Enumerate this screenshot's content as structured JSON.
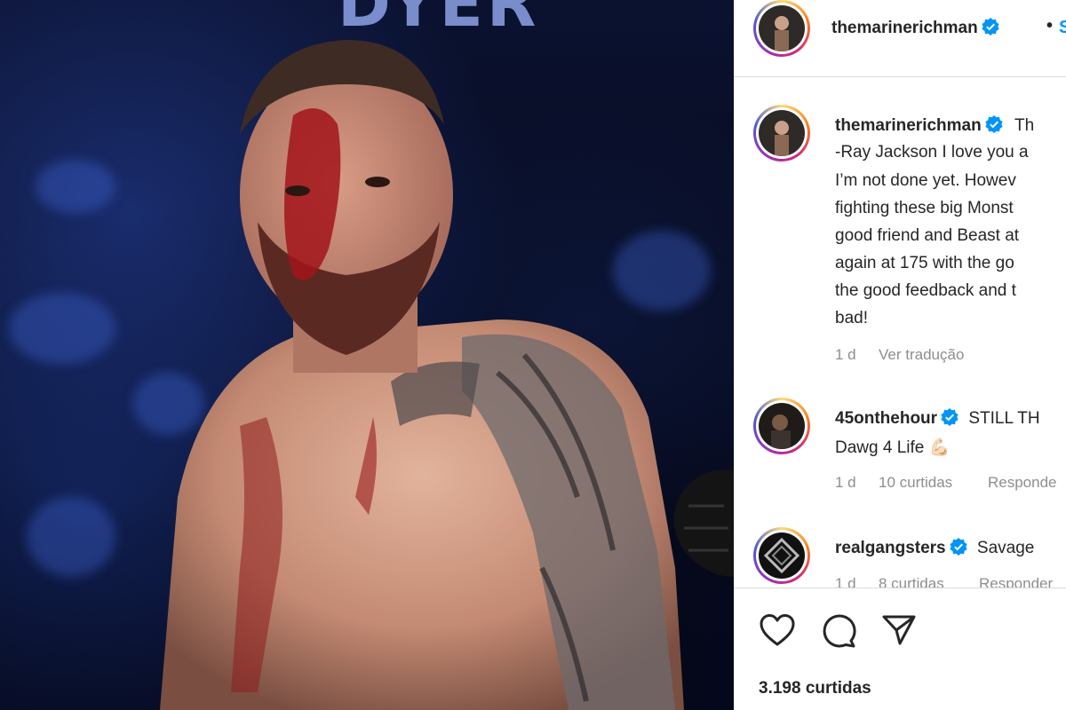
{
  "photo": {
    "banner_text": "DYER",
    "alt": "fighter-photo"
  },
  "post": {
    "author": "themarinerichman",
    "separator": "•",
    "follow_label": "S"
  },
  "caption": {
    "author": "themarinerichman",
    "lines": [
      "Th",
      "-Ray Jackson I love you a",
      "I’m not done yet. Howev",
      "fighting these big Monst",
      "good friend and Beast at",
      "again at 175 with the go",
      "the good feedback and t",
      "bad!"
    ],
    "time": "1 d",
    "translate_label": "Ver tradução"
  },
  "comments": [
    {
      "author": "45onthehour",
      "text_line1": "STILL TH",
      "text_line2": "Dawg 4 Life 💪🏻",
      "time": "1 d",
      "likes": "10 curtidas",
      "reply_label": "Responde"
    },
    {
      "author": "realgangsters",
      "text_line1": "Savage",
      "time": "1 d",
      "likes": "8 curtidas",
      "reply_label": "Responder"
    }
  ],
  "likes_count": "3.198 curtidas",
  "icons": {
    "like": "heart-icon",
    "comment": "comment-icon",
    "share": "share-icon",
    "verified": "verified-badge-icon"
  },
  "colors": {
    "verified": "#0095f6",
    "link": "#0095f6",
    "muted": "#8e8e8e",
    "text": "#262626"
  }
}
